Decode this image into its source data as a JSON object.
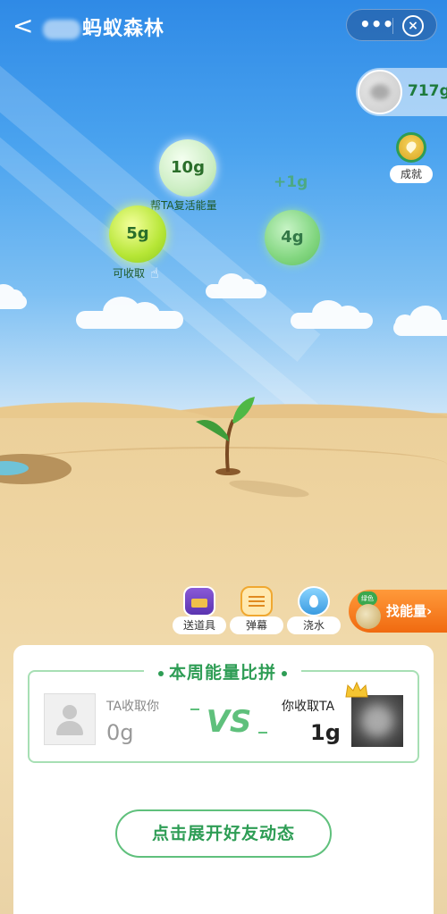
{
  "header": {
    "title": "蚂蚁森林",
    "more_icon": "more-dots-icon",
    "close_icon": "close-circle-icon"
  },
  "energy": {
    "total": "717g"
  },
  "achievement": {
    "label": "成就"
  },
  "energy_balls": [
    {
      "value": "10g",
      "label": "帮TA复活能量"
    },
    {
      "value": "5g",
      "label": "可收取"
    },
    {
      "value": "4g",
      "label": ""
    }
  ],
  "floating_text": "+1g",
  "actions": [
    {
      "label": "送道具",
      "icon": "gift-box-icon"
    },
    {
      "label": "弹幕",
      "icon": "barrage-message-icon"
    },
    {
      "label": "浇水",
      "icon": "water-drop-icon"
    }
  ],
  "find_energy": {
    "label": "找能量",
    "badge": "绿色",
    "arrow": "›"
  },
  "weekly_pk": {
    "title": "本周能量比拼",
    "ta_collect_label": "TA收取你",
    "ta_collect_value": "0g",
    "vs": "VS",
    "you_collect_label": "你收取TA",
    "you_collect_value": "1g"
  },
  "expand_button": "点击展开好友动态",
  "colors": {
    "accent_green": "#2e9d55",
    "orange": "#f06a10",
    "sky": "#4aa3ef",
    "sand": "#efd6a4"
  }
}
